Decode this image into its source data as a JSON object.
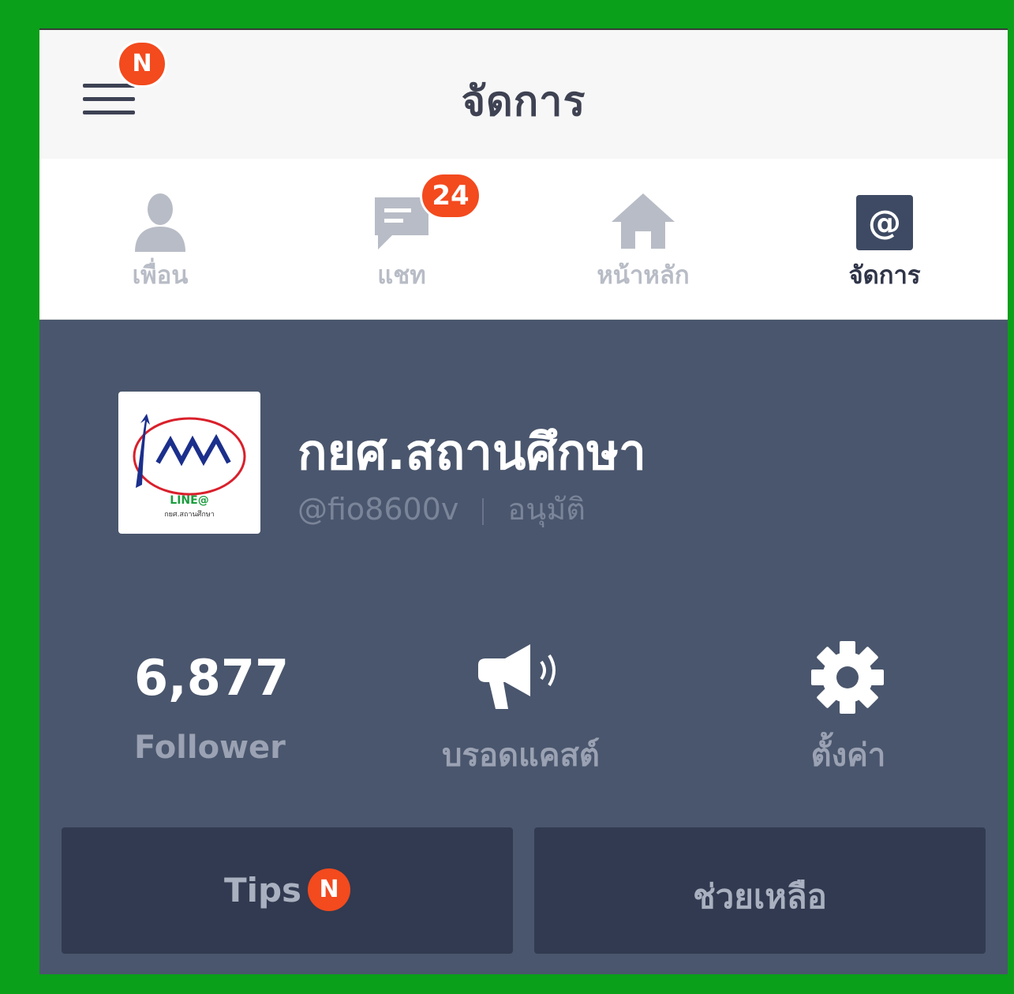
{
  "header": {
    "title": "จัดการ",
    "menu_badge": "N"
  },
  "tabs": [
    {
      "label": "เพื่อน",
      "icon": "person-icon",
      "active": false
    },
    {
      "label": "แชท",
      "icon": "chat-icon",
      "active": false,
      "badge": "24"
    },
    {
      "label": "หน้าหลัก",
      "icon": "home-icon",
      "active": false
    },
    {
      "label": "จัดการ",
      "icon": "at-icon",
      "active": true
    }
  ],
  "profile": {
    "name": "กยศ.สถานศึกษา",
    "id": "@fio8600v",
    "status": "อนุมัติ",
    "logo": {
      "brand": "LINE@",
      "text": "กยศ.สถานศึกษา"
    }
  },
  "stats": {
    "follower_count": "6,877",
    "follower_label": "Follower",
    "broadcast_label": "บรอดแคสต์",
    "settings_label": "ตั้งค่า"
  },
  "buttons": {
    "tips_label": "Tips",
    "tips_badge": "N",
    "help_label": "ช่วยเหลือ"
  },
  "colors": {
    "frame": "#0aa01a",
    "panel": "#4a566d",
    "button": "#313a50",
    "badge": "#f34a1e",
    "active_tab": "#2f3448"
  }
}
